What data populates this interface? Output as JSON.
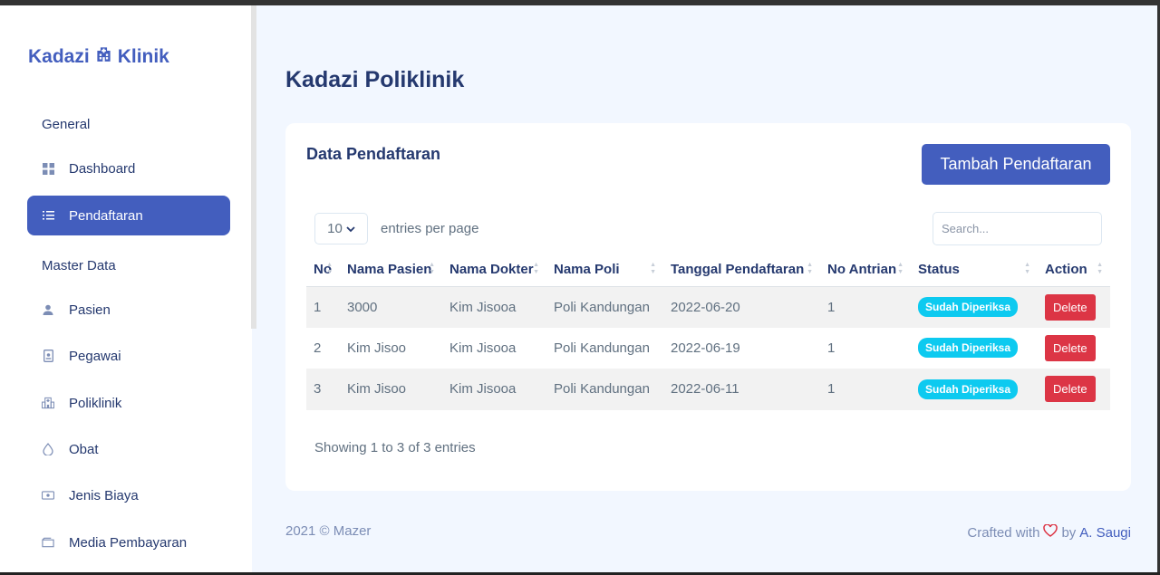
{
  "brand": {
    "name_left": "Kadazi",
    "name_right": "Klinik",
    "icon": "hospital-icon"
  },
  "sidebar": {
    "section_general": "General",
    "section_master": "Master Data",
    "items": [
      {
        "label": "Dashboard",
        "icon": "grid-icon",
        "active": false
      },
      {
        "label": "Pendaftaran",
        "icon": "list-icon",
        "active": true
      },
      {
        "label": "Pasien",
        "icon": "person-icon",
        "active": false
      },
      {
        "label": "Pegawai",
        "icon": "badge-icon",
        "active": false
      },
      {
        "label": "Poliklinik",
        "icon": "building-icon",
        "active": false
      },
      {
        "label": "Obat",
        "icon": "droplet-icon",
        "active": false
      },
      {
        "label": "Jenis Biaya",
        "icon": "cash-icon",
        "active": false
      },
      {
        "label": "Media Pembayaran",
        "icon": "wallet-icon",
        "active": false
      }
    ]
  },
  "page": {
    "title": "Kadazi Poliklinik"
  },
  "card": {
    "title": "Data Pendaftaran",
    "add_button": "Tambah Pendaftaran",
    "per_page_value": "10",
    "per_page_label": "entries per page",
    "search_placeholder": "Search...",
    "columns": [
      "No",
      "Nama Pasien",
      "Nama Dokter",
      "Nama Poli",
      "Tanggal Pendaftaran",
      "No Antrian",
      "Status",
      "Action"
    ],
    "rows": [
      {
        "no": "1",
        "pasien": "3000",
        "dokter": "Kim Jisooa",
        "poli": "Poli Kandungan",
        "tanggal": "2022-06-20",
        "antrian": "1",
        "status": "Sudah Diperiksa",
        "action": "Delete"
      },
      {
        "no": "2",
        "pasien": "Kim Jisoo",
        "dokter": "Kim Jisooa",
        "poli": "Poli Kandungan",
        "tanggal": "2022-06-19",
        "antrian": "1",
        "status": "Sudah Diperiksa",
        "action": "Delete"
      },
      {
        "no": "3",
        "pasien": "Kim Jisoo",
        "dokter": "Kim Jisooa",
        "poli": "Poli Kandungan",
        "tanggal": "2022-06-11",
        "antrian": "1",
        "status": "Sudah Diperiksa",
        "action": "Delete"
      }
    ],
    "showing": "Showing 1 to 3 of 3 entries"
  },
  "footer": {
    "left": "2021 © Mazer",
    "crafted": "Crafted with",
    "by": "by",
    "author": "A. Saugi"
  },
  "colors": {
    "primary": "#435ebe",
    "danger": "#dc3545",
    "info": "#0dcaf0",
    "background": "#f2f7ff"
  }
}
